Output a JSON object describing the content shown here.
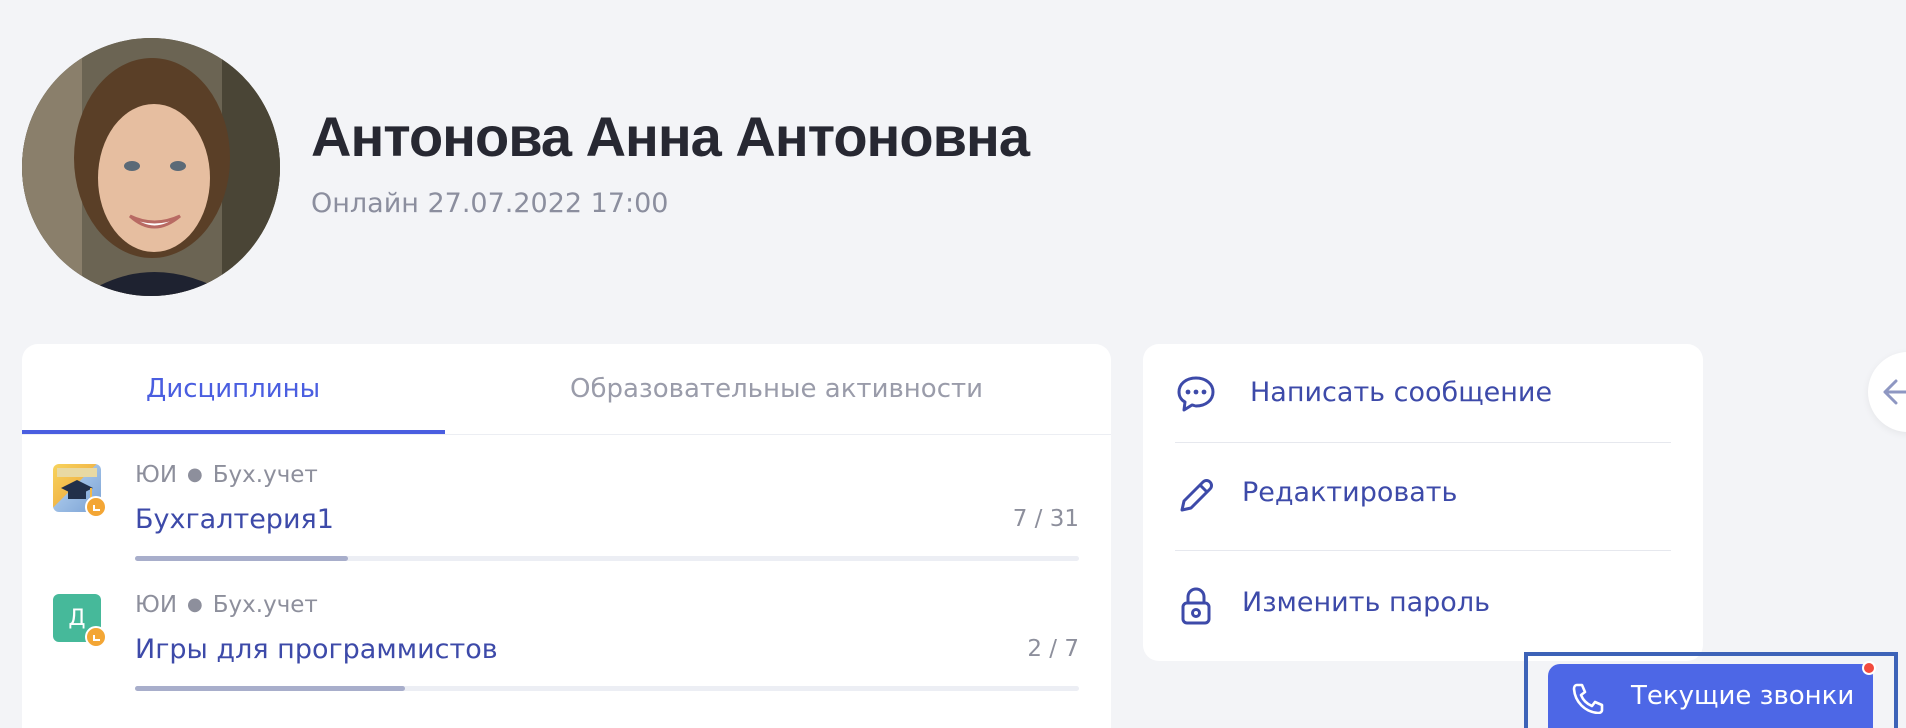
{
  "profile": {
    "name": "Антонова Анна Антоновна",
    "online_status": "Онлайн 27.07.2022 17:00",
    "avatar_icon": "user-photo"
  },
  "tabs": [
    {
      "label": "Дисциплины",
      "active": true
    },
    {
      "label": "Образовательные активности",
      "active": false
    }
  ],
  "courses": [
    {
      "org": "ЮИ",
      "category": "Бух.учет",
      "title": "Бухгалтерия1",
      "progress_text": "7 / 31",
      "progress": 0.226,
      "icon": "graduation-cap-image"
    },
    {
      "org": "ЮИ",
      "category": "Бух.учет",
      "title": "Игры для программистов",
      "progress_text": "2 / 7",
      "progress": 0.286,
      "icon_letter": "Д"
    }
  ],
  "actions": [
    {
      "label": "Написать сообщение",
      "icon": "chat-bubble-icon"
    },
    {
      "label": "Редактировать",
      "icon": "pencil-icon"
    },
    {
      "label": "Изменить пароль",
      "icon": "lock-icon"
    }
  ],
  "calls": {
    "label": "Текущие звонки",
    "icon": "phone-icon",
    "has_notification": true
  },
  "colors": {
    "accent": "#4a5ee0",
    "link": "#3d4aa9",
    "calls_button": "#4d67e6",
    "notification": "#f24a3d",
    "badge": "#f3a635",
    "letter_icon_bg": "#46b99a"
  }
}
